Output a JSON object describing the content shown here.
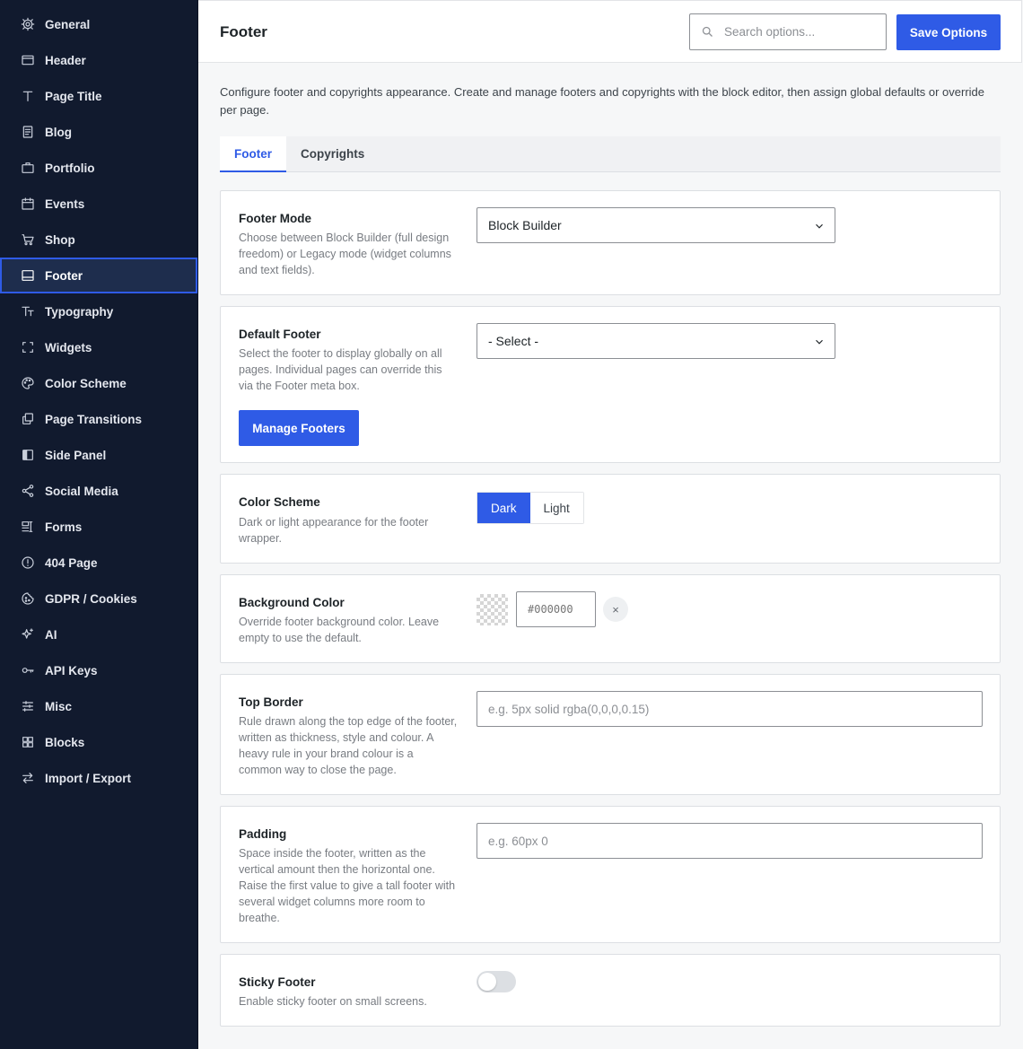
{
  "sidebar": {
    "items": [
      {
        "label": "General",
        "icon": "gear-icon"
      },
      {
        "label": "Header",
        "icon": "window-icon"
      },
      {
        "label": "Page Title",
        "icon": "text-t-icon"
      },
      {
        "label": "Blog",
        "icon": "document-icon"
      },
      {
        "label": "Portfolio",
        "icon": "briefcase-icon"
      },
      {
        "label": "Events",
        "icon": "calendar-icon"
      },
      {
        "label": "Shop",
        "icon": "cart-icon"
      },
      {
        "label": "Footer",
        "icon": "footer-layout-icon",
        "active": true
      },
      {
        "label": "Typography",
        "icon": "typography-icon"
      },
      {
        "label": "Widgets",
        "icon": "widgets-icon"
      },
      {
        "label": "Color Scheme",
        "icon": "palette-icon"
      },
      {
        "label": "Page Transitions",
        "icon": "layers-icon"
      },
      {
        "label": "Side Panel",
        "icon": "side-panel-icon"
      },
      {
        "label": "Social Media",
        "icon": "share-icon"
      },
      {
        "label": "Forms",
        "icon": "forms-icon"
      },
      {
        "label": "404 Page",
        "icon": "alert-circle-icon"
      },
      {
        "label": "GDPR / Cookies",
        "icon": "cookie-icon"
      },
      {
        "label": "AI",
        "icon": "sparkle-icon"
      },
      {
        "label": "API Keys",
        "icon": "key-icon"
      },
      {
        "label": "Misc",
        "icon": "sliders-icon"
      },
      {
        "label": "Blocks",
        "icon": "blocks-grid-icon"
      },
      {
        "label": "Import / Export",
        "icon": "arrows-swap-icon"
      }
    ]
  },
  "header": {
    "title": "Footer",
    "search_placeholder": "Search options...",
    "save_label": "Save Options"
  },
  "intro": "Configure footer and copyrights appearance. Create and manage footers and copyrights with the block editor, then assign global defaults or override per page.",
  "tabs": [
    {
      "label": "Footer",
      "active": true
    },
    {
      "label": "Copyrights",
      "active": false
    }
  ],
  "fields": {
    "footer_mode": {
      "label": "Footer Mode",
      "desc": "Choose between Block Builder (full design freedom) or Legacy mode (widget columns and text fields).",
      "value": "Block Builder"
    },
    "default_footer": {
      "label": "Default Footer",
      "desc": "Select the footer to display globally on all pages. Individual pages can override this via the Footer meta box.",
      "value": "- Select -",
      "button": "Manage Footers"
    },
    "color_scheme": {
      "label": "Color Scheme",
      "desc": "Dark or light appearance for the footer wrapper.",
      "options": [
        "Dark",
        "Light"
      ],
      "selected": "Dark"
    },
    "background_color": {
      "label": "Background Color",
      "desc": "Override footer background color. Leave empty to use the default.",
      "placeholder": "#000000",
      "clear": "×"
    },
    "top_border": {
      "label": "Top Border",
      "desc": "Rule drawn along the top edge of the footer, written as thickness, style and colour. A heavy rule in your brand colour is a common way to close the page.",
      "placeholder": "e.g. 5px solid rgba(0,0,0,0.15)"
    },
    "padding": {
      "label": "Padding",
      "desc": "Space inside the footer, written as the vertical amount then the horizontal one. Raise the first value to give a tall footer with several widget columns more room to breathe.",
      "placeholder": "e.g. 60px 0"
    },
    "sticky_footer": {
      "label": "Sticky Footer",
      "desc": "Enable sticky footer on small screens.",
      "enabled": false
    }
  },
  "colors": {
    "accent": "#2f5be6",
    "sidebar_bg": "#111a2e"
  }
}
